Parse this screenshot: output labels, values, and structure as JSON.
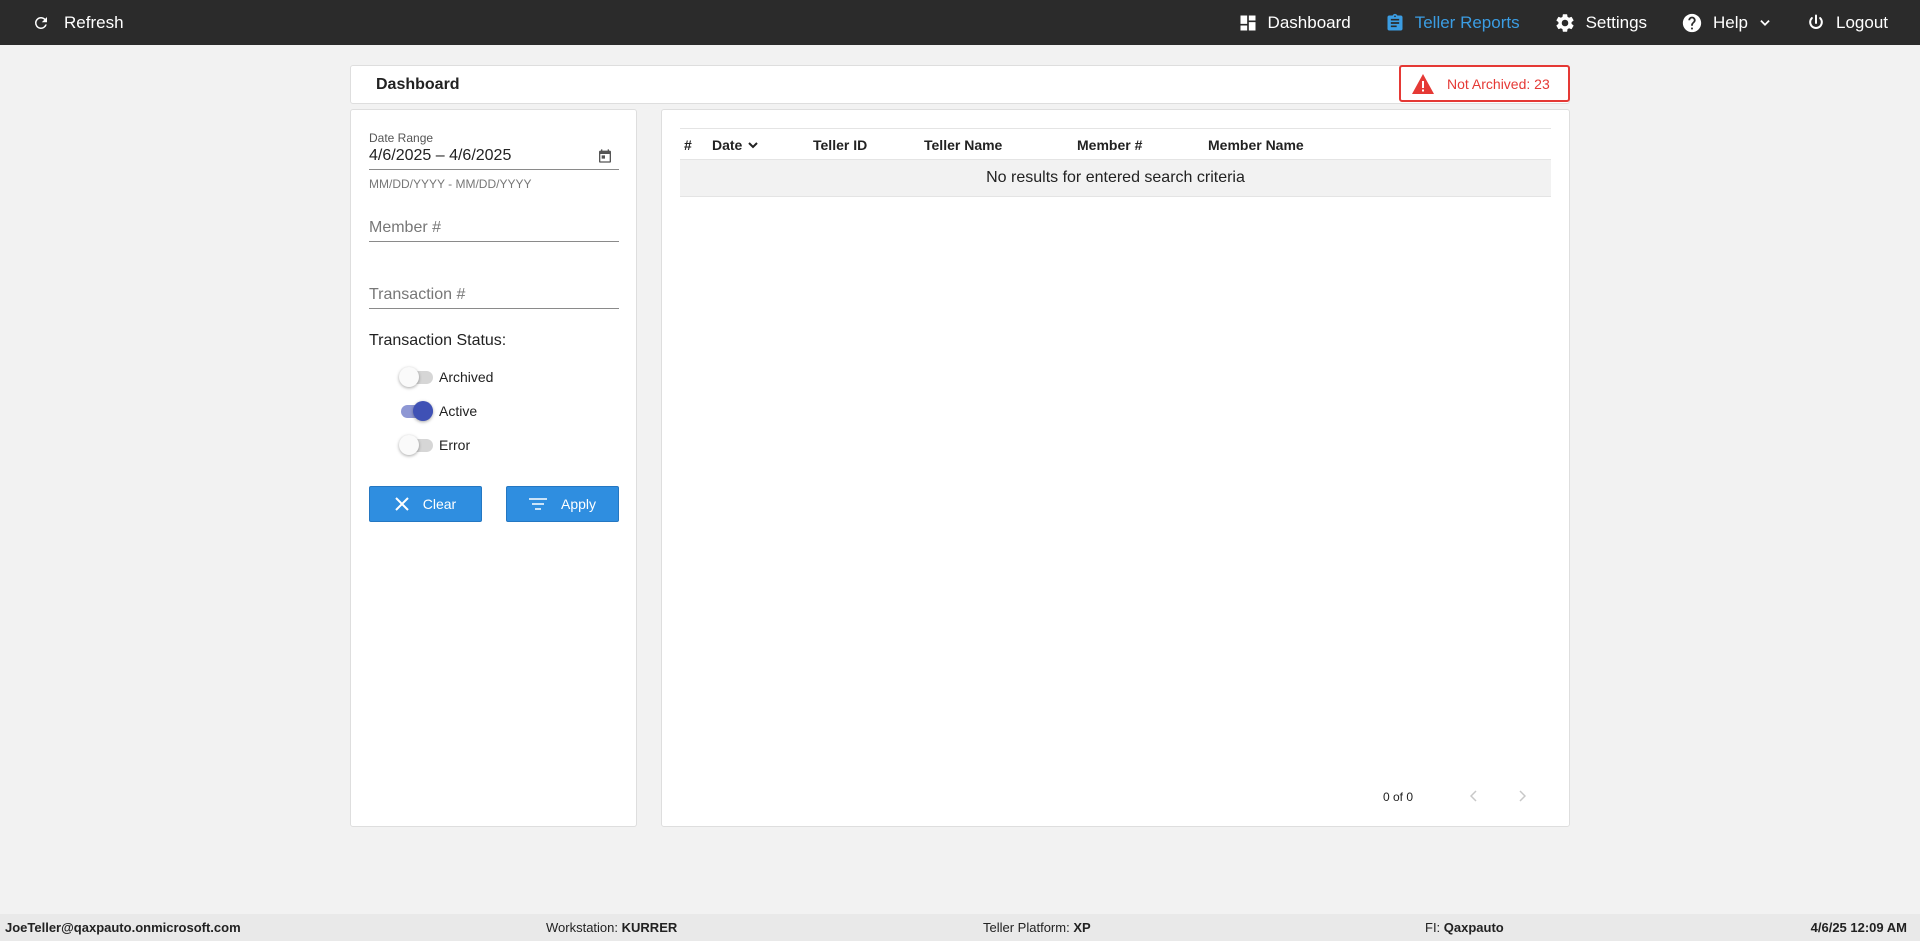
{
  "nav": {
    "refresh_label": "Refresh",
    "dashboard_label": "Dashboard",
    "teller_reports_label": "Teller Reports",
    "settings_label": "Settings",
    "help_label": "Help",
    "logout_label": "Logout",
    "active_item": "Teller Reports"
  },
  "header": {
    "title": "Dashboard",
    "not_archived_label": "Not Archived: 23"
  },
  "filters": {
    "date_range_label": "Date Range",
    "date_range_value": "4/6/2025 – 4/6/2025",
    "date_range_hint": "MM/DD/YYYY - MM/DD/YYYY",
    "member_placeholder": "Member #",
    "transaction_placeholder": "Transaction #",
    "status_label": "Transaction Status:",
    "statuses": [
      {
        "label": "Archived",
        "on": false
      },
      {
        "label": "Active",
        "on": true
      },
      {
        "label": "Error",
        "on": false
      }
    ],
    "clear_label": "Clear",
    "apply_label": "Apply"
  },
  "table": {
    "columns": [
      "#",
      "Date",
      "Teller ID",
      "Teller Name",
      "Member #",
      "Member Name"
    ],
    "empty_message": "No results for entered search criteria",
    "pager_text": "0 of 0"
  },
  "footer": {
    "user": "JoeTeller@qaxpauto.onmicrosoft.com",
    "workstation_label": "Workstation:",
    "workstation_value": "KURRER",
    "platform_label": "Teller Platform:",
    "platform_value": "XP",
    "fi_label": "FI:",
    "fi_value": "Qaxpauto",
    "datetime": "4/6/25 12:09 AM"
  },
  "colors": {
    "nav_bg": "#2b2b2b",
    "accent": "#2f8ee0",
    "active_nav": "#3b9de3",
    "alert": "#e53935",
    "toggle_on": "#3f51b5"
  }
}
